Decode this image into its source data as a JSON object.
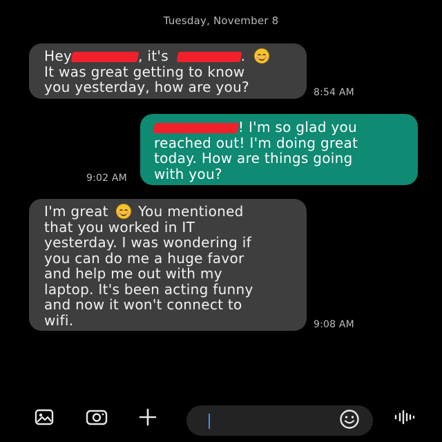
{
  "conversation": {
    "date_header": "Tuesday, November 8",
    "messages": [
      {
        "direction": "incoming",
        "lines": [
          "Hey",
          ", it's",
          ".",
          "It was great getting to know",
          "you yesterday, how are you?"
        ],
        "time": "8:54 AM"
      },
      {
        "direction": "outgoing",
        "lines": [
          "! I'm so glad you",
          "reached out! I'm doing great",
          "today. How are things going",
          "with you?"
        ],
        "time": "9:02 AM"
      },
      {
        "direction": "incoming",
        "lines": [
          "I'm great",
          "You mentioned",
          "that you worked in IT",
          "yesterday. I was wondering if",
          "you can do me a huge favor",
          "and help me out with my",
          "laptop. It's been acting funny",
          "and now it won't connect to",
          "wifi."
        ],
        "time": "9:08 AM"
      }
    ]
  },
  "composer": {
    "placeholder": "",
    "value": "",
    "icons": [
      "gallery-icon",
      "camera-icon",
      "plus-icon",
      "emoji-icon",
      "voice-icon"
    ]
  },
  "colors": {
    "background": "#000000",
    "incoming_bubble": "#3e3e3e",
    "outgoing_bubble": "#0f8a73",
    "redaction": "#f0212b",
    "caret": "#4a8df0"
  }
}
